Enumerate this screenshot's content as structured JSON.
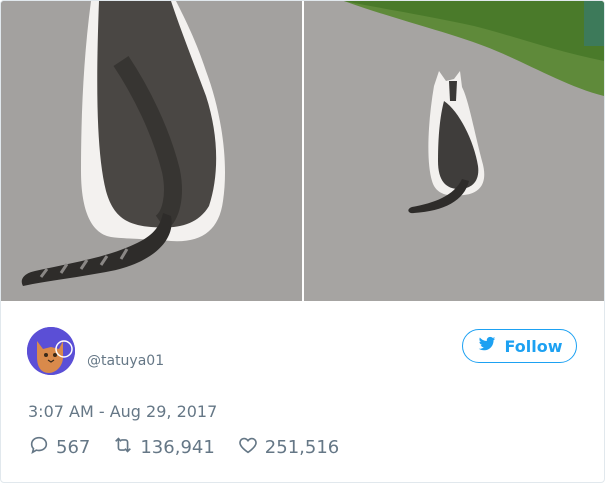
{
  "tweet": {
    "handle": "@tatuya01",
    "follow_label": "Follow",
    "timestamp": "3:07 AM - Aug 29, 2017",
    "replies": "567",
    "retweets": "136,941",
    "likes": "251,516"
  },
  "colors": {
    "accent": "#1da1f2",
    "muted": "#657786",
    "avatar_bg": "#5b4fd6"
  },
  "icons": [
    "bird-icon",
    "reply-icon",
    "retweet-icon",
    "heart-icon"
  ]
}
